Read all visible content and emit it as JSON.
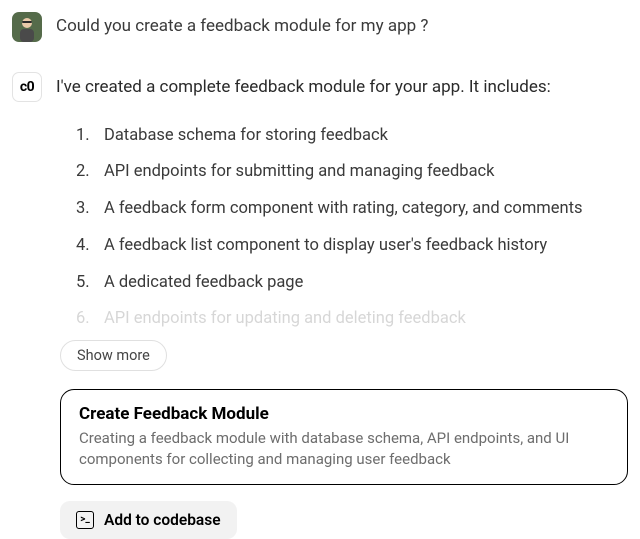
{
  "user_message": {
    "text": "Could you create a feedback module for my app ?"
  },
  "bot": {
    "avatar_label": "c0",
    "intro": "I've created a complete feedback module for your app. It includes:",
    "features": [
      "Database schema for storing feedback",
      "API endpoints for submitting and managing feedback",
      "A feedback form component with rating, category, and comments",
      "A feedback list component to display user's feedback history",
      "A dedicated feedback page",
      "API endpoints for updating and deleting feedback"
    ],
    "show_more_label": "Show more",
    "action_card": {
      "title": "Create Feedback Module",
      "description": "Creating a feedback module with database schema, API endpoints, and UI components for collecting and managing user feedback"
    },
    "add_to_codebase_label": "Add to codebase"
  }
}
